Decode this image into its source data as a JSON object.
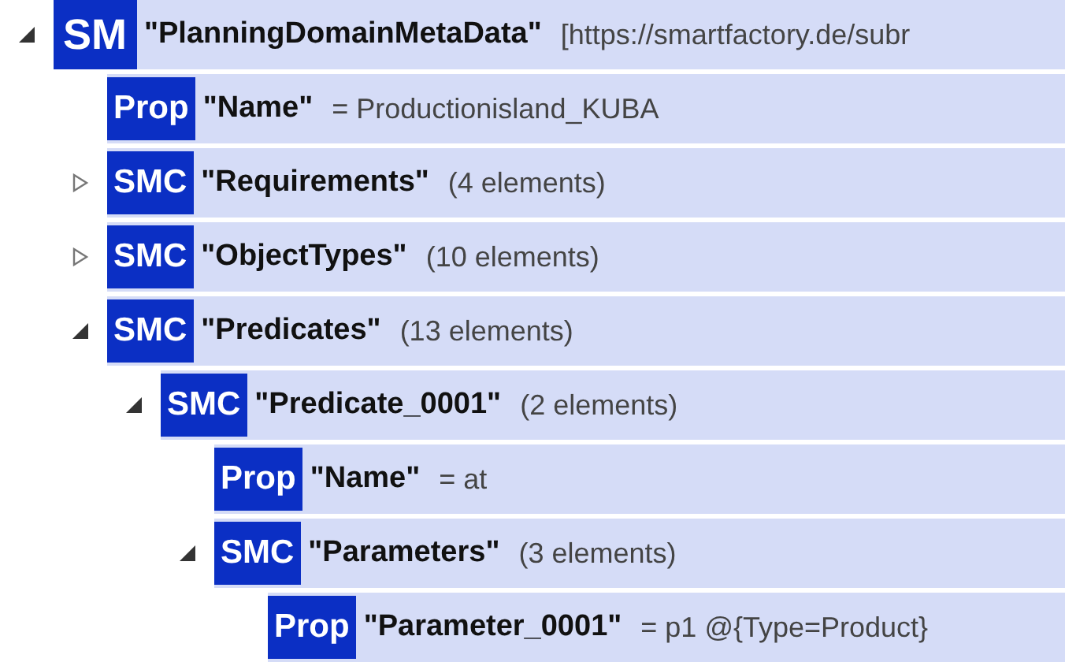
{
  "tree": [
    {
      "badge": "SM",
      "name": "\"PlanningDomainMetaData\"",
      "info": "[https://smartfactory.de/subr",
      "expanded": true,
      "children": [
        {
          "badge": "Prop",
          "name": "\"Name\"",
          "info": "= Productionisland_KUBA"
        },
        {
          "badge": "SMC",
          "name": "\"Requirements\"",
          "info": "(4 elements)",
          "expanded": false
        },
        {
          "badge": "SMC",
          "name": "\"ObjectTypes\"",
          "info": "(10 elements)",
          "expanded": false
        },
        {
          "badge": "SMC",
          "name": "\"Predicates\"",
          "info": "(13 elements)",
          "expanded": true,
          "children": [
            {
              "badge": "SMC",
              "name": "\"Predicate_0001\"",
              "info": "(2 elements)",
              "expanded": true,
              "children": [
                {
                  "badge": "Prop",
                  "name": "\"Name\"",
                  "info": "= at"
                },
                {
                  "badge": "SMC",
                  "name": "\"Parameters\"",
                  "info": "(3 elements)",
                  "expanded": true,
                  "children": [
                    {
                      "badge": "Prop",
                      "name": "\"Parameter_0001\"",
                      "info": "= p1 @{Type=Product}"
                    }
                  ]
                }
              ]
            }
          ]
        }
      ]
    }
  ]
}
